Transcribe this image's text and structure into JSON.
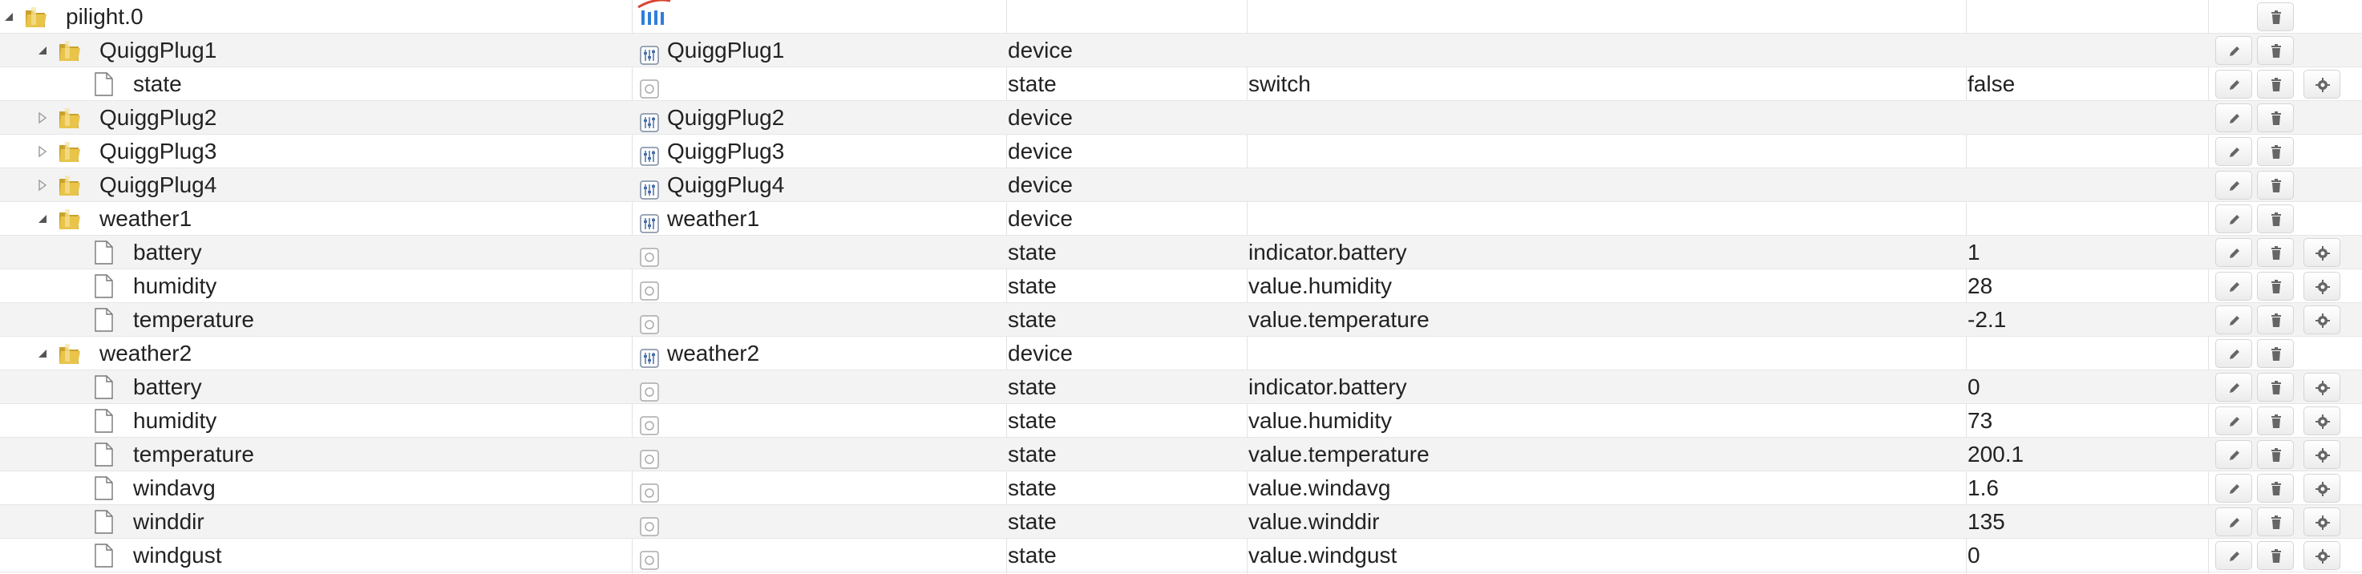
{
  "rows": [
    {
      "id": "pilight.0",
      "name": "",
      "type": "",
      "role": "",
      "value": "",
      "level": 0,
      "kind": "folder",
      "expand": "expanded",
      "name_icon": "pilight-logo-icon",
      "buttons": [
        "delete"
      ]
    },
    {
      "id": "QuiggPlug1",
      "name": "QuiggPlug1",
      "type": "device",
      "role": "",
      "value": "",
      "level": 1,
      "kind": "folder",
      "expand": "expanded",
      "name_icon": "device-icon",
      "buttons": [
        "edit",
        "delete"
      ]
    },
    {
      "id": "state",
      "name": "",
      "type": "state",
      "role": "switch",
      "value": "false",
      "level": 2,
      "kind": "file",
      "expand": "none",
      "name_icon": "state-icon",
      "buttons": [
        "edit",
        "delete",
        "settings"
      ]
    },
    {
      "id": "QuiggPlug2",
      "name": "QuiggPlug2",
      "type": "device",
      "role": "",
      "value": "",
      "level": 1,
      "kind": "folder",
      "expand": "collapsed",
      "name_icon": "device-icon",
      "buttons": [
        "edit",
        "delete"
      ]
    },
    {
      "id": "QuiggPlug3",
      "name": "QuiggPlug3",
      "type": "device",
      "role": "",
      "value": "",
      "level": 1,
      "kind": "folder",
      "expand": "collapsed",
      "name_icon": "device-icon",
      "buttons": [
        "edit",
        "delete"
      ]
    },
    {
      "id": "QuiggPlug4",
      "name": "QuiggPlug4",
      "type": "device",
      "role": "",
      "value": "",
      "level": 1,
      "kind": "folder",
      "expand": "collapsed",
      "name_icon": "device-icon",
      "buttons": [
        "edit",
        "delete"
      ]
    },
    {
      "id": "weather1",
      "name": "weather1",
      "type": "device",
      "role": "",
      "value": "",
      "level": 1,
      "kind": "folder",
      "expand": "expanded",
      "name_icon": "device-icon",
      "buttons": [
        "edit",
        "delete"
      ]
    },
    {
      "id": "battery",
      "name": "",
      "type": "state",
      "role": "indicator.battery",
      "value": "1",
      "level": 2,
      "kind": "file",
      "expand": "none",
      "name_icon": "state-icon",
      "buttons": [
        "edit",
        "delete",
        "settings"
      ]
    },
    {
      "id": "humidity",
      "name": "",
      "type": "state",
      "role": "value.humidity",
      "value": "28",
      "level": 2,
      "kind": "file",
      "expand": "none",
      "name_icon": "state-icon",
      "buttons": [
        "edit",
        "delete",
        "settings"
      ]
    },
    {
      "id": "temperature",
      "name": "",
      "type": "state",
      "role": "value.temperature",
      "value": "-2.1",
      "level": 2,
      "kind": "file",
      "expand": "none",
      "name_icon": "state-icon",
      "buttons": [
        "edit",
        "delete",
        "settings"
      ]
    },
    {
      "id": "weather2",
      "name": "weather2",
      "type": "device",
      "role": "",
      "value": "",
      "level": 1,
      "kind": "folder",
      "expand": "expanded",
      "name_icon": "device-icon",
      "buttons": [
        "edit",
        "delete"
      ]
    },
    {
      "id": "battery",
      "name": "",
      "type": "state",
      "role": "indicator.battery",
      "value": "0",
      "level": 2,
      "kind": "file",
      "expand": "none",
      "name_icon": "state-icon",
      "buttons": [
        "edit",
        "delete",
        "settings"
      ]
    },
    {
      "id": "humidity",
      "name": "",
      "type": "state",
      "role": "value.humidity",
      "value": "73",
      "level": 2,
      "kind": "file",
      "expand": "none",
      "name_icon": "state-icon",
      "buttons": [
        "edit",
        "delete",
        "settings"
      ]
    },
    {
      "id": "temperature",
      "name": "",
      "type": "state",
      "role": "value.temperature",
      "value": "200.1",
      "level": 2,
      "kind": "file",
      "expand": "none",
      "name_icon": "state-icon",
      "buttons": [
        "edit",
        "delete",
        "settings"
      ]
    },
    {
      "id": "windavg",
      "name": "",
      "type": "state",
      "role": "value.windavg",
      "value": "1.6",
      "level": 2,
      "kind": "file",
      "expand": "none",
      "name_icon": "state-icon",
      "buttons": [
        "edit",
        "delete",
        "settings"
      ]
    },
    {
      "id": "winddir",
      "name": "",
      "type": "state",
      "role": "value.winddir",
      "value": "135",
      "level": 2,
      "kind": "file",
      "expand": "none",
      "name_icon": "state-icon",
      "buttons": [
        "edit",
        "delete",
        "settings"
      ]
    },
    {
      "id": "windgust",
      "name": "",
      "type": "state",
      "role": "value.windgust",
      "value": "0",
      "level": 2,
      "kind": "file",
      "expand": "none",
      "name_icon": "state-icon",
      "buttons": [
        "edit",
        "delete",
        "settings"
      ]
    }
  ],
  "colors": {
    "folder": "#e8c44a",
    "folder_dark": "#c9a12c",
    "row_alt": "#f3f3f3",
    "device_icon": "#4a6fa5",
    "pilight_red": "#d9432f",
    "pilight_blue": "#2f7fd9"
  }
}
